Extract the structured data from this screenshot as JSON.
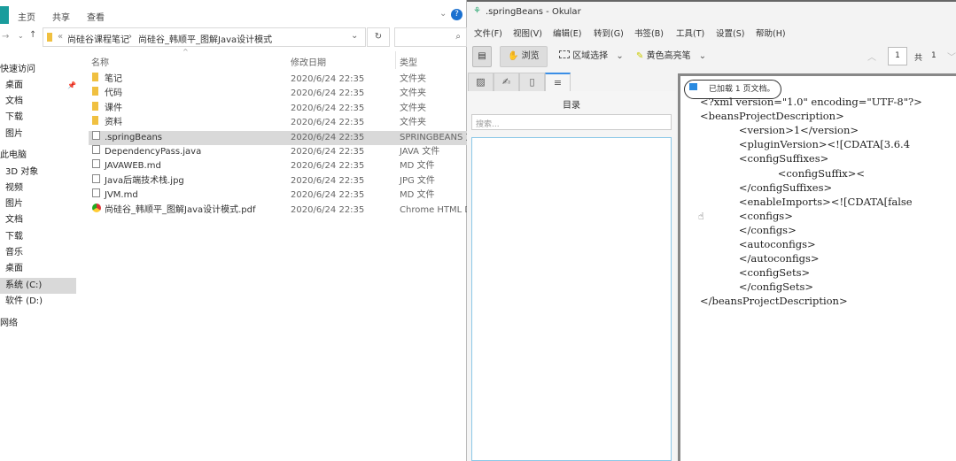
{
  "explorer": {
    "ribbon_tabs": [
      "主页",
      "共享",
      "查看"
    ],
    "breadcrumb": [
      "尚硅谷课程笔记",
      "尚硅谷_韩顺平_图解Java设计模式"
    ],
    "columns": [
      "名称",
      "修改日期",
      "类型"
    ],
    "sidebar": [
      {
        "label": "快速访问"
      },
      {
        "label": "桌面"
      },
      {
        "label": "文档"
      },
      {
        "label": "下载"
      },
      {
        "label": "图片"
      },
      {
        "label": "此电脑"
      },
      {
        "label": "3D 对象"
      },
      {
        "label": "视频"
      },
      {
        "label": "图片"
      },
      {
        "label": "文档"
      },
      {
        "label": "下载"
      },
      {
        "label": "音乐"
      },
      {
        "label": "桌面"
      },
      {
        "label": "系统 (C:)"
      },
      {
        "label": "软件 (D:)"
      },
      {
        "label": "网络"
      }
    ],
    "files": [
      {
        "name": "笔记",
        "date": "2020/6/24 22:35",
        "type": "文件夹",
        "icon": "folder"
      },
      {
        "name": "代码",
        "date": "2020/6/24 22:35",
        "type": "文件夹",
        "icon": "folder"
      },
      {
        "name": "课件",
        "date": "2020/6/24 22:35",
        "type": "文件夹",
        "icon": "folder"
      },
      {
        "name": "资料",
        "date": "2020/6/24 22:35",
        "type": "文件夹",
        "icon": "folder"
      },
      {
        "name": ".springBeans",
        "date": "2020/6/24 22:35",
        "type": "SPRINGBEANS 文",
        "icon": "file"
      },
      {
        "name": "DependencyPass.java",
        "date": "2020/6/24 22:35",
        "type": "JAVA 文件",
        "icon": "file"
      },
      {
        "name": "JAVAWEB.md",
        "date": "2020/6/24 22:35",
        "type": "MD 文件",
        "icon": "file"
      },
      {
        "name": "Java后端技术栈.jpg",
        "date": "2020/6/24 22:35",
        "type": "JPG 文件",
        "icon": "file"
      },
      {
        "name": "JVM.md",
        "date": "2020/6/24 22:35",
        "type": "MD 文件",
        "icon": "file"
      },
      {
        "name": "尚硅谷_韩顺平_图解Java设计模式.pdf",
        "date": "2020/6/24 22:35",
        "type": "Chrome HTML Do",
        "icon": "chrome"
      }
    ]
  },
  "okular": {
    "title": ".springBeans - Okular",
    "menu": [
      "文件(F)",
      "视图(V)",
      "编辑(E)",
      "转到(G)",
      "书签(B)",
      "工具(T)",
      "设置(S)",
      "帮助(H)"
    ],
    "browse": "浏览",
    "area_select": "区域选择",
    "highlighter": "黄色高亮笔",
    "page_current": "1",
    "page_of": "共",
    "page_total": "1",
    "toc_title": "目录",
    "search_placeholder": "搜索...",
    "notice": "已加载 1 页文档。",
    "lines": [
      "<?xml version=\"1.0\" encoding=\"UTF-8\"?>",
      "<beansProjectDescription>",
      "            <version>1</version>",
      "            <pluginVersion><![CDATA[3.6.4",
      "            <configSuffixes>",
      "                        <configSuffix><",
      "            </configSuffixes>",
      "            <enableImports><![CDATA[false",
      "            <configs>",
      "            </configs>",
      "            <autoconfigs>",
      "            </autoconfigs>",
      "            <configSets>",
      "            </configSets>",
      "</beansProjectDescription>"
    ]
  }
}
